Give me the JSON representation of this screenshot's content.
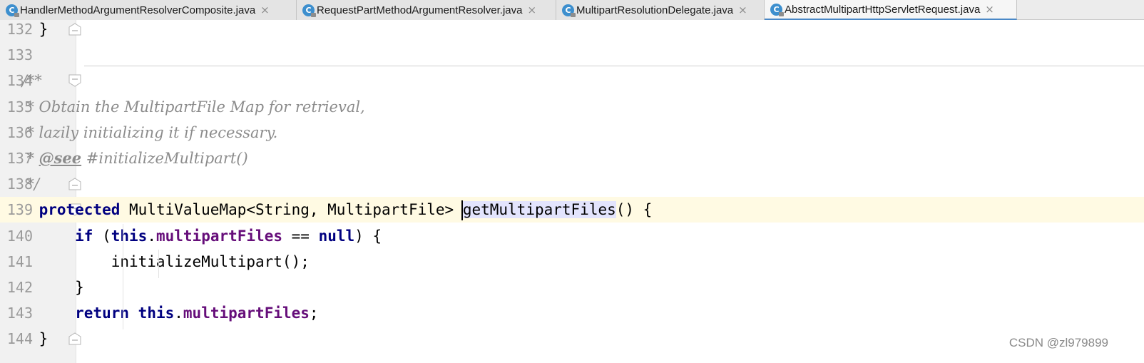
{
  "tabs": [
    {
      "label": "HandlerMethodArgumentResolverComposite.java",
      "icon": "class-icon",
      "active": false
    },
    {
      "label": "RequestPartMethodArgumentResolver.java",
      "icon": "class-icon",
      "active": false
    },
    {
      "label": "MultipartResolutionDelegate.java",
      "icon": "class-icon",
      "active": false
    },
    {
      "label": "AbstractMultipartHttpServletRequest.java",
      "icon": "class-icon",
      "active": true
    }
  ],
  "tab_icon_letter": "C",
  "close_glyph": "×",
  "lines": [
    {
      "num": "132",
      "fold": "end",
      "parts": [
        {
          "t": "    }",
          "c": "plain"
        }
      ]
    },
    {
      "num": "133",
      "fold": "",
      "parts": []
    },
    {
      "num": "134",
      "fold": "start",
      "parts": [
        {
          "t": "    /**",
          "c": "comment"
        }
      ]
    },
    {
      "num": "135",
      "fold": "",
      "parts": [
        {
          "t": "     * Obtain the MultipartFile Map for retrieval,",
          "c": "comment"
        }
      ]
    },
    {
      "num": "136",
      "fold": "",
      "parts": [
        {
          "t": "     * lazily initializing it if necessary.",
          "c": "comment"
        }
      ]
    },
    {
      "num": "137",
      "fold": "",
      "parts": [
        {
          "t": "     * ",
          "c": "comment"
        },
        {
          "t": "@see",
          "c": "tag"
        },
        {
          "t": " #initializeMultipart()",
          "c": "comment"
        }
      ]
    },
    {
      "num": "138",
      "fold": "end",
      "parts": [
        {
          "t": "     */",
          "c": "comment"
        }
      ]
    },
    {
      "num": "139",
      "fold": "start",
      "current": true,
      "parts": [
        {
          "t": "    ",
          "c": "plain"
        },
        {
          "t": "protected",
          "c": "kw"
        },
        {
          "t": " MultiValueMap<String, MultipartFile> ",
          "c": "plain"
        },
        {
          "t": "getMultipartFiles",
          "c": "sel"
        },
        {
          "t": "() {",
          "c": "plain"
        }
      ]
    },
    {
      "num": "140",
      "fold": "",
      "parts": [
        {
          "t": "        ",
          "c": "plain"
        },
        {
          "t": "if",
          "c": "kw"
        },
        {
          "t": " (",
          "c": "plain"
        },
        {
          "t": "this",
          "c": "kw"
        },
        {
          "t": ".",
          "c": "plain"
        },
        {
          "t": "multipartFiles",
          "c": "field"
        },
        {
          "t": " == ",
          "c": "plain"
        },
        {
          "t": "null",
          "c": "kw"
        },
        {
          "t": ") {",
          "c": "plain"
        }
      ]
    },
    {
      "num": "141",
      "fold": "",
      "parts": [
        {
          "t": "            initializeMultipart();",
          "c": "plain"
        }
      ]
    },
    {
      "num": "142",
      "fold": "",
      "parts": [
        {
          "t": "        }",
          "c": "plain"
        }
      ]
    },
    {
      "num": "143",
      "fold": "",
      "parts": [
        {
          "t": "        ",
          "c": "plain"
        },
        {
          "t": "return",
          "c": "kw"
        },
        {
          "t": " ",
          "c": "plain"
        },
        {
          "t": "this",
          "c": "kw"
        },
        {
          "t": ".",
          "c": "plain"
        },
        {
          "t": "multipartFiles",
          "c": "field"
        },
        {
          "t": ";",
          "c": "plain"
        }
      ]
    },
    {
      "num": "144",
      "fold": "end",
      "parts": [
        {
          "t": "    }",
          "c": "plain"
        }
      ]
    }
  ],
  "watermark": "CSDN @zl979899",
  "colors": {
    "keyword": "#000080",
    "field": "#660e7a",
    "comment": "#8c8c8c",
    "current_line": "#fffae3",
    "selection": "#e3e4fd"
  }
}
